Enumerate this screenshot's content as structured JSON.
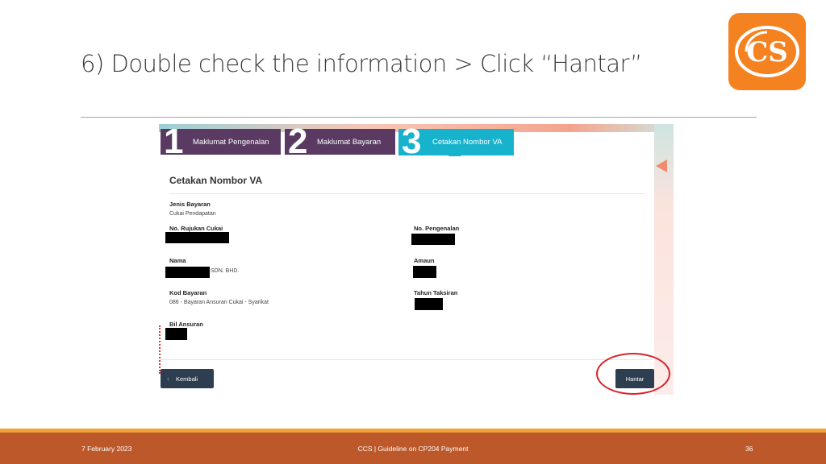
{
  "slide": {
    "title": "6) Double check the information > Click “Hantar”",
    "logo_text": "CS"
  },
  "steps": [
    {
      "number": "1",
      "label": "Maklumat Pengenalan"
    },
    {
      "number": "2",
      "label": "Maklumat Bayaran"
    },
    {
      "number": "3",
      "label": "Cetakan Nombor VA"
    }
  ],
  "card": {
    "title": "Cetakan Nombor VA",
    "fields": {
      "jenis_bayaran": {
        "label": "Jenis Bayaran",
        "value": "Cukai Pendapatan"
      },
      "no_rujukan_cukai": {
        "label": "No. Rujukan Cukai"
      },
      "no_pengenalan": {
        "label": "No. Pengenalan"
      },
      "nama": {
        "label": "Nama",
        "value": "SDN. BHD."
      },
      "amaun": {
        "label": "Amaun"
      },
      "kod_bayaran": {
        "label": "Kod Bayaran",
        "value": "086 - Bayaran Ansuran Cukai - Syarikat"
      },
      "tahun_taksiran": {
        "label": "Tahun Taksiran"
      },
      "bil_ansuran": {
        "label": "Bil Ansuran"
      }
    }
  },
  "buttons": {
    "back_label": "Kembali",
    "submit_label": "Hantar"
  },
  "footer": {
    "date": "7 February 2023",
    "center": "CCS | Guideline on CP204 Payment",
    "page": "36"
  },
  "colors": {
    "step_inactive": "#5a3a63",
    "step_active": "#17b2cb",
    "button": "#2c3e50",
    "highlight": "#d9232a",
    "footer": "#bc582a",
    "logo": "#f58220"
  }
}
